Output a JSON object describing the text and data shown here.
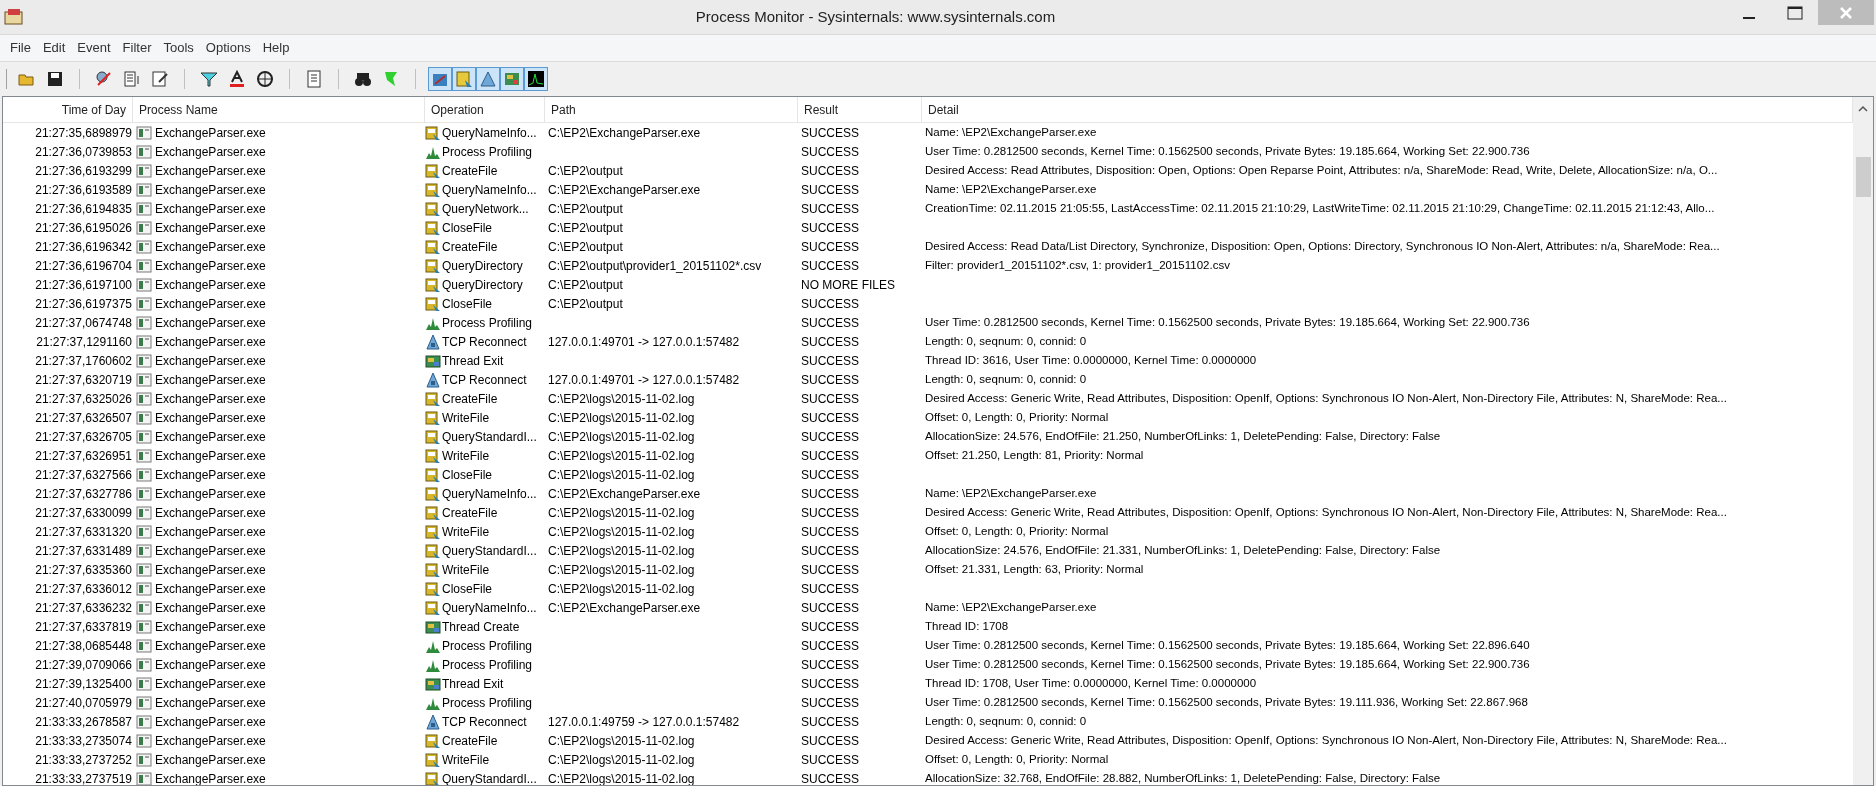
{
  "window": {
    "title": "Process Monitor - Sysinternals: www.sysinternals.com"
  },
  "menu": [
    "File",
    "Edit",
    "Event",
    "Filter",
    "Tools",
    "Options",
    "Help"
  ],
  "toolbar": {
    "toggles": [
      {
        "selected": true
      },
      {
        "selected": true
      },
      {
        "selected": true
      },
      {
        "selected": true
      },
      {
        "selected": true
      }
    ]
  },
  "table": {
    "columns": [
      "Time of Day",
      "Process Name",
      "Operation",
      "Path",
      "Result",
      "Detail"
    ],
    "rows": [
      {
        "time": "21:27:35,6898979",
        "process": "ExchangeParser.exe",
        "kind": "file",
        "operation": "QueryNameInfo...",
        "path": "C:\\EP2\\ExchangeParser.exe",
        "result": "SUCCESS",
        "detail": "Name: \\EP2\\ExchangeParser.exe"
      },
      {
        "time": "21:27:36,0739853",
        "process": "ExchangeParser.exe",
        "kind": "profiling",
        "operation": "Process Profiling",
        "result": "SUCCESS",
        "detail": "User Time: 0.2812500 seconds, Kernel Time: 0.1562500 seconds, Private Bytes: 19.185.664, Working Set: 22.900.736"
      },
      {
        "time": "21:27:36,6193299",
        "process": "ExchangeParser.exe",
        "kind": "file",
        "operation": "CreateFile",
        "path": "C:\\EP2\\output",
        "result": "SUCCESS",
        "detail": "Desired Access: Read Attributes, Disposition: Open, Options: Open Reparse Point, Attributes: n/a, ShareMode: Read, Write, Delete, AllocationSize: n/a, O..."
      },
      {
        "time": "21:27:36,6193589",
        "process": "ExchangeParser.exe",
        "kind": "file",
        "operation": "QueryNameInfo...",
        "path": "C:\\EP2\\ExchangeParser.exe",
        "result": "SUCCESS",
        "detail": "Name: \\EP2\\ExchangeParser.exe"
      },
      {
        "time": "21:27:36,6194835",
        "process": "ExchangeParser.exe",
        "kind": "file",
        "operation": "QueryNetwork...",
        "path": "C:\\EP2\\output",
        "result": "SUCCESS",
        "detail": "CreationTime: 02.11.2015 21:05:55, LastAccessTime: 02.11.2015 21:10:29, LastWriteTime: 02.11.2015 21:10:29, ChangeTime: 02.11.2015 21:12:43, Allo..."
      },
      {
        "time": "21:27:36,6195026",
        "process": "ExchangeParser.exe",
        "kind": "file",
        "operation": "CloseFile",
        "path": "C:\\EP2\\output",
        "result": "SUCCESS"
      },
      {
        "time": "21:27:36,6196342",
        "process": "ExchangeParser.exe",
        "kind": "file",
        "operation": "CreateFile",
        "path": "C:\\EP2\\output",
        "result": "SUCCESS",
        "detail": "Desired Access: Read Data/List Directory, Synchronize, Disposition: Open, Options: Directory, Synchronous IO Non-Alert, Attributes: n/a, ShareMode: Rea..."
      },
      {
        "time": "21:27:36,6196704",
        "process": "ExchangeParser.exe",
        "kind": "file",
        "operation": "QueryDirectory",
        "path": "C:\\EP2\\output\\provider1_20151102*.csv",
        "result": "SUCCESS",
        "detail": "Filter: provider1_20151102*.csv, 1: provider1_20151102.csv"
      },
      {
        "time": "21:27:36,6197100",
        "process": "ExchangeParser.exe",
        "kind": "file",
        "operation": "QueryDirectory",
        "path": "C:\\EP2\\output",
        "result": "NO MORE FILES"
      },
      {
        "time": "21:27:36,6197375",
        "process": "ExchangeParser.exe",
        "kind": "file",
        "operation": "CloseFile",
        "path": "C:\\EP2\\output",
        "result": "SUCCESS"
      },
      {
        "time": "21:27:37,0674748",
        "process": "ExchangeParser.exe",
        "kind": "profiling",
        "operation": "Process Profiling",
        "result": "SUCCESS",
        "detail": "User Time: 0.2812500 seconds, Kernel Time: 0.1562500 seconds, Private Bytes: 19.185.664, Working Set: 22.900.736"
      },
      {
        "time": "21:27:37,1291160",
        "process": "ExchangeParser.exe",
        "kind": "network",
        "operation": "TCP Reconnect",
        "path": "127.0.0.1:49701 -> 127.0.0.1:57482",
        "result": "SUCCESS",
        "detail": "Length: 0, seqnum: 0, connid: 0"
      },
      {
        "time": "21:27:37,1760602",
        "process": "ExchangeParser.exe",
        "kind": "thread",
        "operation": "Thread Exit",
        "result": "SUCCESS",
        "detail": "Thread ID: 3616, User Time: 0.0000000, Kernel Time: 0.0000000"
      },
      {
        "time": "21:27:37,6320719",
        "process": "ExchangeParser.exe",
        "kind": "network",
        "operation": "TCP Reconnect",
        "path": "127.0.0.1:49701 -> 127.0.0.1:57482",
        "result": "SUCCESS",
        "detail": "Length: 0, seqnum: 0, connid: 0"
      },
      {
        "time": "21:27:37,6325026",
        "process": "ExchangeParser.exe",
        "kind": "file",
        "operation": "CreateFile",
        "path": "C:\\EP2\\logs\\2015-11-02.log",
        "result": "SUCCESS",
        "detail": "Desired Access: Generic Write, Read Attributes, Disposition: OpenIf, Options: Synchronous IO Non-Alert, Non-Directory File, Attributes: N, ShareMode: Rea..."
      },
      {
        "time": "21:27:37,6326507",
        "process": "ExchangeParser.exe",
        "kind": "file",
        "operation": "WriteFile",
        "path": "C:\\EP2\\logs\\2015-11-02.log",
        "result": "SUCCESS",
        "detail": "Offset: 0, Length: 0, Priority: Normal"
      },
      {
        "time": "21:27:37,6326705",
        "process": "ExchangeParser.exe",
        "kind": "file",
        "operation": "QueryStandardI...",
        "path": "C:\\EP2\\logs\\2015-11-02.log",
        "result": "SUCCESS",
        "detail": "AllocationSize: 24.576, EndOfFile: 21.250, NumberOfLinks: 1, DeletePending: False, Directory: False"
      },
      {
        "time": "21:27:37,6326951",
        "process": "ExchangeParser.exe",
        "kind": "file",
        "operation": "WriteFile",
        "path": "C:\\EP2\\logs\\2015-11-02.log",
        "result": "SUCCESS",
        "detail": "Offset: 21.250, Length: 81, Priority: Normal"
      },
      {
        "time": "21:27:37,6327566",
        "process": "ExchangeParser.exe",
        "kind": "file",
        "operation": "CloseFile",
        "path": "C:\\EP2\\logs\\2015-11-02.log",
        "result": "SUCCESS"
      },
      {
        "time": "21:27:37,6327786",
        "process": "ExchangeParser.exe",
        "kind": "file",
        "operation": "QueryNameInfo...",
        "path": "C:\\EP2\\ExchangeParser.exe",
        "result": "SUCCESS",
        "detail": "Name: \\EP2\\ExchangeParser.exe"
      },
      {
        "time": "21:27:37,6330099",
        "process": "ExchangeParser.exe",
        "kind": "file",
        "operation": "CreateFile",
        "path": "C:\\EP2\\logs\\2015-11-02.log",
        "result": "SUCCESS",
        "detail": "Desired Access: Generic Write, Read Attributes, Disposition: OpenIf, Options: Synchronous IO Non-Alert, Non-Directory File, Attributes: N, ShareMode: Rea..."
      },
      {
        "time": "21:27:37,6331320",
        "process": "ExchangeParser.exe",
        "kind": "file",
        "operation": "WriteFile",
        "path": "C:\\EP2\\logs\\2015-11-02.log",
        "result": "SUCCESS",
        "detail": "Offset: 0, Length: 0, Priority: Normal"
      },
      {
        "time": "21:27:37,6331489",
        "process": "ExchangeParser.exe",
        "kind": "file",
        "operation": "QueryStandardI...",
        "path": "C:\\EP2\\logs\\2015-11-02.log",
        "result": "SUCCESS",
        "detail": "AllocationSize: 24.576, EndOfFile: 21.331, NumberOfLinks: 1, DeletePending: False, Directory: False"
      },
      {
        "time": "21:27:37,6335360",
        "process": "ExchangeParser.exe",
        "kind": "file",
        "operation": "WriteFile",
        "path": "C:\\EP2\\logs\\2015-11-02.log",
        "result": "SUCCESS",
        "detail": "Offset: 21.331, Length: 63, Priority: Normal"
      },
      {
        "time": "21:27:37,6336012",
        "process": "ExchangeParser.exe",
        "kind": "file",
        "operation": "CloseFile",
        "path": "C:\\EP2\\logs\\2015-11-02.log",
        "result": "SUCCESS"
      },
      {
        "time": "21:27:37,6336232",
        "process": "ExchangeParser.exe",
        "kind": "file",
        "operation": "QueryNameInfo...",
        "path": "C:\\EP2\\ExchangeParser.exe",
        "result": "SUCCESS",
        "detail": "Name: \\EP2\\ExchangeParser.exe"
      },
      {
        "time": "21:27:37,6337819",
        "process": "ExchangeParser.exe",
        "kind": "thread",
        "operation": "Thread Create",
        "result": "SUCCESS",
        "detail": "Thread ID: 1708"
      },
      {
        "time": "21:27:38,0685448",
        "process": "ExchangeParser.exe",
        "kind": "profiling",
        "operation": "Process Profiling",
        "result": "SUCCESS",
        "detail": "User Time: 0.2812500 seconds, Kernel Time: 0.1562500 seconds, Private Bytes: 19.185.664, Working Set: 22.896.640"
      },
      {
        "time": "21:27:39,0709066",
        "process": "ExchangeParser.exe",
        "kind": "profiling",
        "operation": "Process Profiling",
        "result": "SUCCESS",
        "detail": "User Time: 0.2812500 seconds, Kernel Time: 0.1562500 seconds, Private Bytes: 19.185.664, Working Set: 22.900.736"
      },
      {
        "time": "21:27:39,1325400",
        "process": "ExchangeParser.exe",
        "kind": "thread",
        "operation": "Thread Exit",
        "result": "SUCCESS",
        "detail": "Thread ID: 1708, User Time: 0.0000000, Kernel Time: 0.0000000"
      },
      {
        "time": "21:27:40,0705979",
        "process": "ExchangeParser.exe",
        "kind": "profiling",
        "operation": "Process Profiling",
        "result": "SUCCESS",
        "detail": "User Time: 0.2812500 seconds, Kernel Time: 0.1562500 seconds, Private Bytes: 19.111.936, Working Set: 22.867.968"
      },
      {
        "time": "21:33:33,2678587",
        "process": "ExchangeParser.exe",
        "kind": "network",
        "operation": "TCP Reconnect",
        "path": "127.0.0.1:49759 -> 127.0.0.1:57482",
        "result": "SUCCESS",
        "detail": "Length: 0, seqnum: 0, connid: 0"
      },
      {
        "time": "21:33:33,2735074",
        "process": "ExchangeParser.exe",
        "kind": "file",
        "operation": "CreateFile",
        "path": "C:\\EP2\\logs\\2015-11-02.log",
        "result": "SUCCESS",
        "detail": "Desired Access: Generic Write, Read Attributes, Disposition: OpenIf, Options: Synchronous IO Non-Alert, Non-Directory File, Attributes: N, ShareMode: Rea..."
      },
      {
        "time": "21:33:33,2737252",
        "process": "ExchangeParser.exe",
        "kind": "file",
        "operation": "WriteFile",
        "path": "C:\\EP2\\logs\\2015-11-02.log",
        "result": "SUCCESS",
        "detail": "Offset: 0, Length: 0, Priority: Normal"
      },
      {
        "time": "21:33:33,2737519",
        "process": "ExchangeParser.exe",
        "kind": "file",
        "operation": "QueryStandardI...",
        "path": "C:\\EP2\\logs\\2015-11-02.log",
        "result": "SUCCESS",
        "detail": "AllocationSize: 32.768, EndOfFile: 28.882, NumberOfLinks: 1, DeletePending: False, Directory: False"
      }
    ]
  }
}
